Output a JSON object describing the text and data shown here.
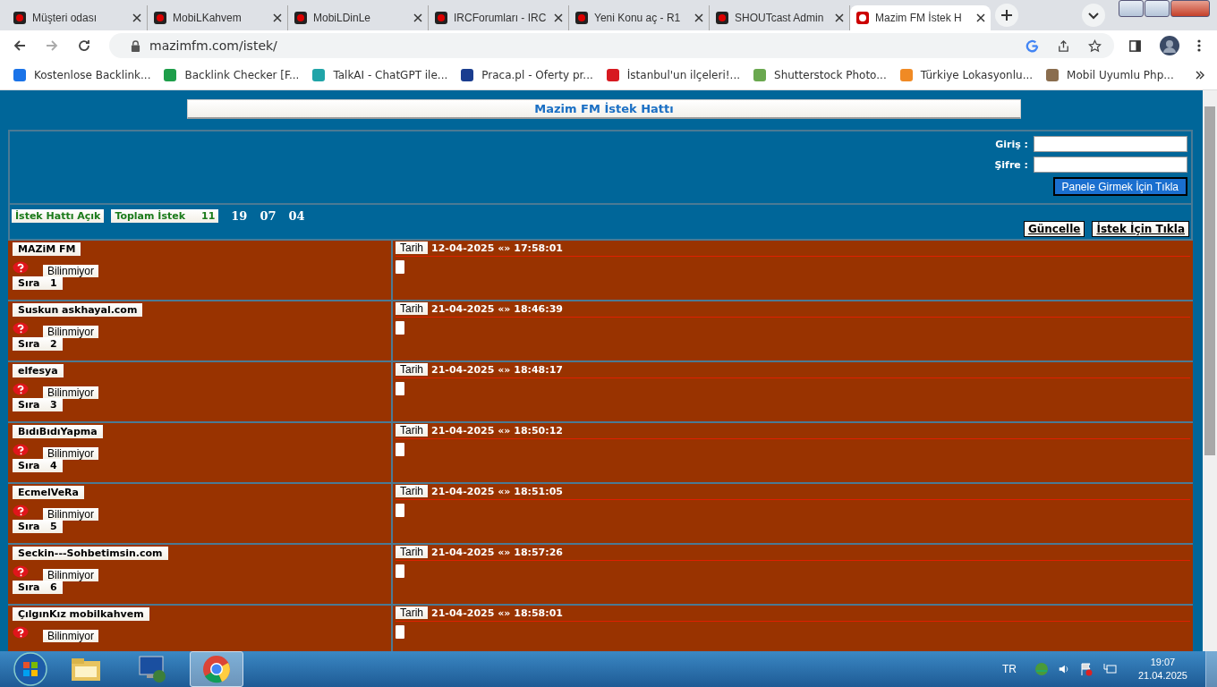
{
  "browser": {
    "tabs": [
      {
        "title": "Müşteri odası",
        "selected": false
      },
      {
        "title": "MobiLKahvem",
        "selected": false
      },
      {
        "title": "MobiLDinLe",
        "selected": false
      },
      {
        "title": "IRCForumları - IRC",
        "selected": false
      },
      {
        "title": "Yeni Konu aç - R1",
        "selected": false
      },
      {
        "title": "SHOUTcast Admin",
        "selected": false
      },
      {
        "title": "Mazim FM İstek H",
        "selected": true
      }
    ],
    "url": "mazimfm.com/istek/",
    "bookmarks": [
      {
        "title": "Kostenlose Backlink...",
        "color": "#1a73e8"
      },
      {
        "title": "Backlink Checker [F...",
        "color": "#1e9e4a"
      },
      {
        "title": "TalkAI - ChatGPT ile...",
        "color": "#20a4a8"
      },
      {
        "title": "Praca.pl - Oferty pr...",
        "color": "#1a3d8f"
      },
      {
        "title": "İstanbul'un ilçeleri!...",
        "color": "#d71920"
      },
      {
        "title": "Shutterstock Photo...",
        "color": "#6aa84f"
      },
      {
        "title": "Türkiye Lokasyonlu...",
        "color": "#f08a24"
      },
      {
        "title": "Mobil Uyumlu Php...",
        "color": "#8a6d4e"
      }
    ]
  },
  "page": {
    "title": "Mazim FM İstek Hattı",
    "login": {
      "user_label": "Giriş :",
      "password_label": "Şifre :",
      "submit": "Panele Girmek İçin Tıkla"
    },
    "status": {
      "open": "İstek Hattı Açık",
      "total_label": "Toplam İstek",
      "total": "11",
      "clock": [
        "19",
        "07",
        "04"
      ]
    },
    "actions": [
      "Güncelle",
      "İstek İçin Tıkla"
    ],
    "requests": [
      {
        "name": "MAZiM FM",
        "song": "Bilinmiyor",
        "order_label": "Sıra",
        "order": "1",
        "date_label": "Tarih",
        "date": "12-04-2025 «» 17:58:01"
      },
      {
        "name": "Suskun askhayal.com",
        "song": "Bilinmiyor",
        "order_label": "Sıra",
        "order": "2",
        "date_label": "Tarih",
        "date": "21-04-2025 «» 18:46:39"
      },
      {
        "name": "elfesya",
        "song": "Bilinmiyor",
        "order_label": "Sıra",
        "order": "3",
        "date_label": "Tarih",
        "date": "21-04-2025 «» 18:48:17"
      },
      {
        "name": "BıdıBıdıYapma",
        "song": "Bilinmiyor",
        "order_label": "Sıra",
        "order": "4",
        "date_label": "Tarih",
        "date": "21-04-2025 «» 18:50:12"
      },
      {
        "name": "EcmelVeRa",
        "song": "Bilinmiyor",
        "order_label": "Sıra",
        "order": "5",
        "date_label": "Tarih",
        "date": "21-04-2025 «» 18:51:05"
      },
      {
        "name": "Seckin---Sohbetimsin.com",
        "song": "Bilinmiyor",
        "order_label": "Sıra",
        "order": "6",
        "date_label": "Tarih",
        "date": "21-04-2025 «» 18:57:26"
      },
      {
        "name": "ÇılgınKız mobilkahvem",
        "song": "Bilinmiyor",
        "date_label": "Tarih",
        "date": "21-04-2025 «» 18:58:01"
      }
    ]
  },
  "taskbar": {
    "language": "TR",
    "time": "19:07",
    "date": "21.04.2025"
  }
}
